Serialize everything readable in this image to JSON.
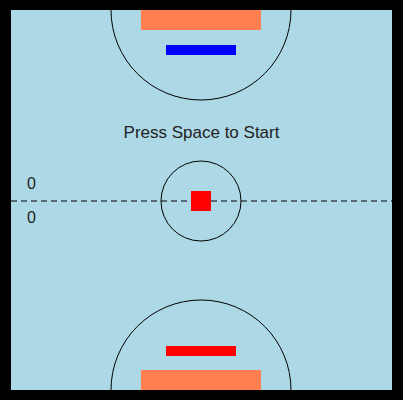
{
  "game": {
    "running": false,
    "status_message": "Press Space to Start"
  },
  "scores": [
    {
      "player": "top",
      "score": "0"
    },
    {
      "player": "bottom",
      "score": "0"
    }
  ],
  "paddles": [
    {
      "player": "top",
      "color": "#0000ff"
    },
    {
      "player": "bottom",
      "color": "#ff0000"
    }
  ],
  "puck": {
    "color": "#ff0000"
  }
}
